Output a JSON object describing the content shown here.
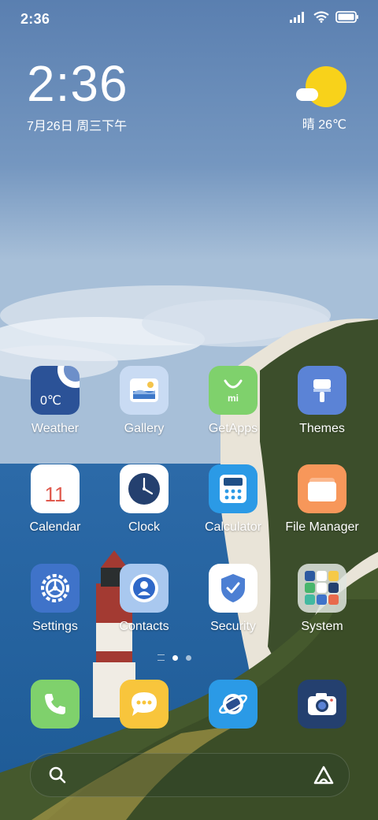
{
  "status_bar": {
    "time": "2:36"
  },
  "clock_widget": {
    "time": "2:36",
    "date": "7月26日 周三下午"
  },
  "weather_widget": {
    "condition_temp": "晴 26℃",
    "icon": "sunny-cloud-icon"
  },
  "apps": [
    {
      "label": "Weather",
      "icon": "weather-icon",
      "badge": "0℃"
    },
    {
      "label": "Gallery",
      "icon": "gallery-icon"
    },
    {
      "label": "GetApps",
      "icon": "getapps-icon",
      "badge": "mi"
    },
    {
      "label": "Themes",
      "icon": "themes-icon"
    },
    {
      "label": "Calendar",
      "icon": "calendar-icon",
      "badge": "11"
    },
    {
      "label": "Clock",
      "icon": "clock-icon"
    },
    {
      "label": "Calculator",
      "icon": "calculator-icon"
    },
    {
      "label": "File Manager",
      "icon": "folder-icon"
    },
    {
      "label": "Settings",
      "icon": "gear-icon"
    },
    {
      "label": "Contacts",
      "icon": "contacts-icon"
    },
    {
      "label": "Security",
      "icon": "shield-icon"
    },
    {
      "label": "System",
      "icon": "folder-grid-icon"
    }
  ],
  "page_indicator": {
    "pages": 2,
    "current": 1
  },
  "dock": [
    {
      "icon": "phone-icon"
    },
    {
      "icon": "messages-icon"
    },
    {
      "icon": "browser-icon"
    },
    {
      "icon": "camera-icon"
    }
  ],
  "search_bar": {
    "left_icon": "search-icon",
    "right_icon": "assistant-icon"
  },
  "colors": {
    "sky_top": "#5e83b2",
    "sea": "#2a67a6",
    "grass": "#3d5128",
    "sun": "#f8d21a"
  }
}
